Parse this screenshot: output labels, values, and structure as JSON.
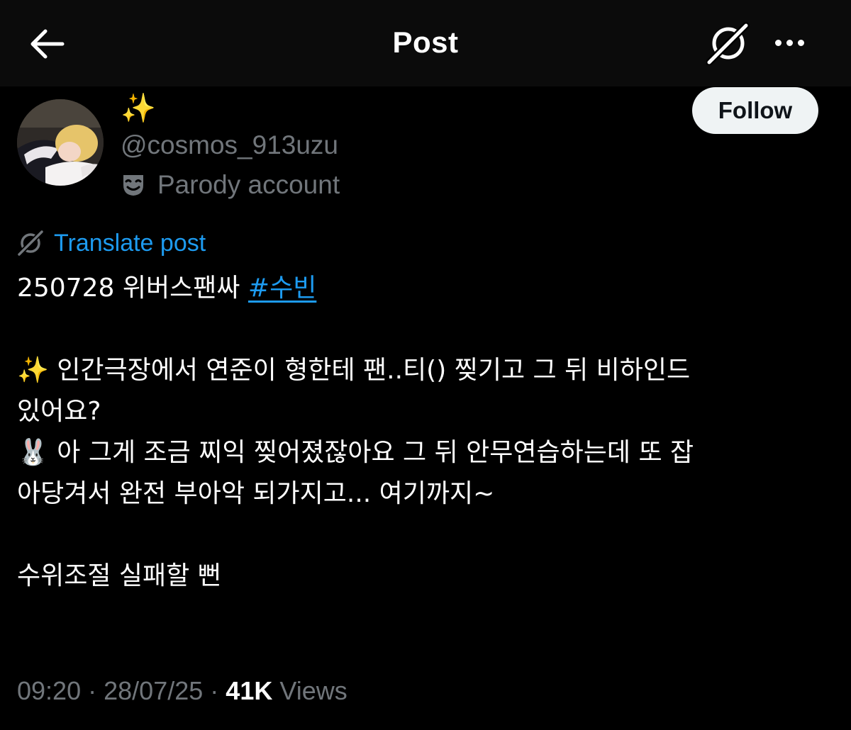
{
  "header": {
    "title": "Post",
    "back_icon": "arrow-left-icon",
    "grok_icon": "grok-icon",
    "more_icon": "more-horizontal-icon"
  },
  "author": {
    "display_name": "✨",
    "handle": "@cosmos_913uzu",
    "label_icon": "parody-mask-icon",
    "label": "Parody account",
    "follow_label": "Follow"
  },
  "translate": {
    "icon": "grok-icon",
    "label": "Translate post"
  },
  "post": {
    "line1_text": "250728 위버스팬싸 ",
    "hashtag": "#수빈",
    "q_emoji": "✨",
    "q_line1": " 인간극장에서 연준이 형한테 팬..티() 찢기고 그 뒤 비하인드",
    "q_line2": "있어요?",
    "a_emoji": "🐰",
    "a_line1": " 아 그게 조금 찌익 찢어졌잖아요 그 뒤 안무연습하는데 또 잡",
    "a_line2": "아당겨서 완전 부아악 되가지고... 여기까지~",
    "closing": "수위조절 실패할 뻔"
  },
  "meta": {
    "time": "09:20",
    "separator": "·",
    "date": "28/07/25",
    "views_count": "41K",
    "views_label": "Views"
  },
  "colors": {
    "background": "#000000",
    "topbar": "#0b0b0b",
    "text_primary": "#ffffff",
    "text_secondary": "#71767b",
    "link": "#1d9bf0",
    "follow_bg": "#eff3f4",
    "follow_text": "#0f1419"
  }
}
